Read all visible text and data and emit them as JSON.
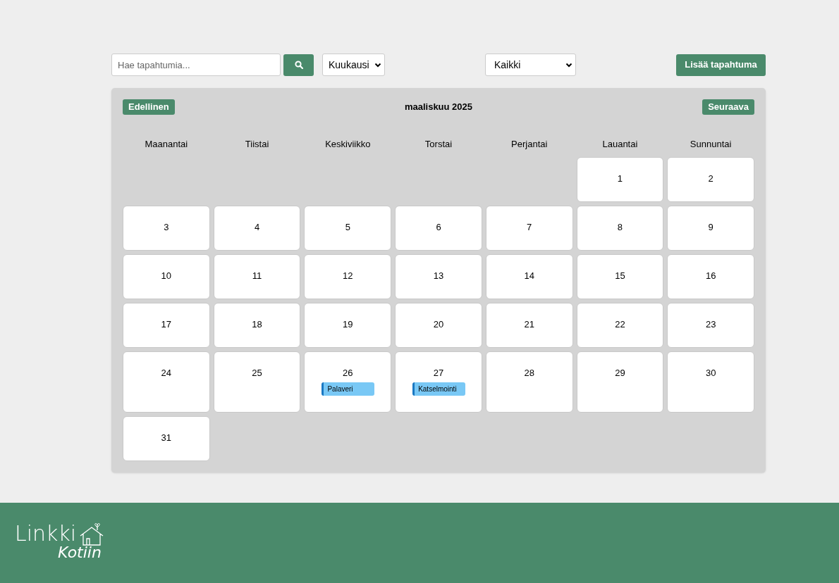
{
  "toolbar": {
    "search": {
      "placeholder": "Hae tapahtumia..."
    },
    "view_select": "Kuukausi",
    "filter_select": "Kaikki",
    "add_button": "Lisää tapahtuma"
  },
  "calendar": {
    "prev_button": "Edellinen",
    "title": "maaliskuu 2025",
    "next_button": "Seuraava",
    "weekdays": [
      "Maanantai",
      "Tiistai",
      "Keskiviikko",
      "Torstai",
      "Perjantai",
      "Lauantai",
      "Sunnuntai"
    ],
    "cells": [
      {
        "kind": "blank"
      },
      {
        "kind": "blank"
      },
      {
        "kind": "blank"
      },
      {
        "kind": "blank"
      },
      {
        "kind": "blank"
      },
      {
        "kind": "day",
        "day": "1"
      },
      {
        "kind": "day",
        "day": "2"
      },
      {
        "kind": "day",
        "day": "3"
      },
      {
        "kind": "day",
        "day": "4"
      },
      {
        "kind": "day",
        "day": "5"
      },
      {
        "kind": "day",
        "day": "6"
      },
      {
        "kind": "day",
        "day": "7"
      },
      {
        "kind": "day",
        "day": "8"
      },
      {
        "kind": "day",
        "day": "9"
      },
      {
        "kind": "day",
        "day": "10"
      },
      {
        "kind": "day",
        "day": "11"
      },
      {
        "kind": "day",
        "day": "12"
      },
      {
        "kind": "day",
        "day": "13"
      },
      {
        "kind": "day",
        "day": "14"
      },
      {
        "kind": "day",
        "day": "15"
      },
      {
        "kind": "day",
        "day": "16"
      },
      {
        "kind": "day",
        "day": "17"
      },
      {
        "kind": "day",
        "day": "18"
      },
      {
        "kind": "day",
        "day": "19"
      },
      {
        "kind": "day",
        "day": "20"
      },
      {
        "kind": "day",
        "day": "21"
      },
      {
        "kind": "day",
        "day": "22"
      },
      {
        "kind": "day",
        "day": "23"
      },
      {
        "kind": "day",
        "day": "24"
      },
      {
        "kind": "day",
        "day": "25"
      },
      {
        "kind": "day",
        "day": "26",
        "events": [
          {
            "title": "Palaveri"
          }
        ]
      },
      {
        "kind": "day",
        "day": "27",
        "events": [
          {
            "title": "Katselmointi"
          }
        ]
      },
      {
        "kind": "day",
        "day": "28"
      },
      {
        "kind": "day",
        "day": "29"
      },
      {
        "kind": "day",
        "day": "30"
      },
      {
        "kind": "day",
        "day": "31"
      }
    ]
  },
  "footer": {
    "logo_line_1": "Linkki",
    "logo_line_2": "Kotiin"
  }
}
